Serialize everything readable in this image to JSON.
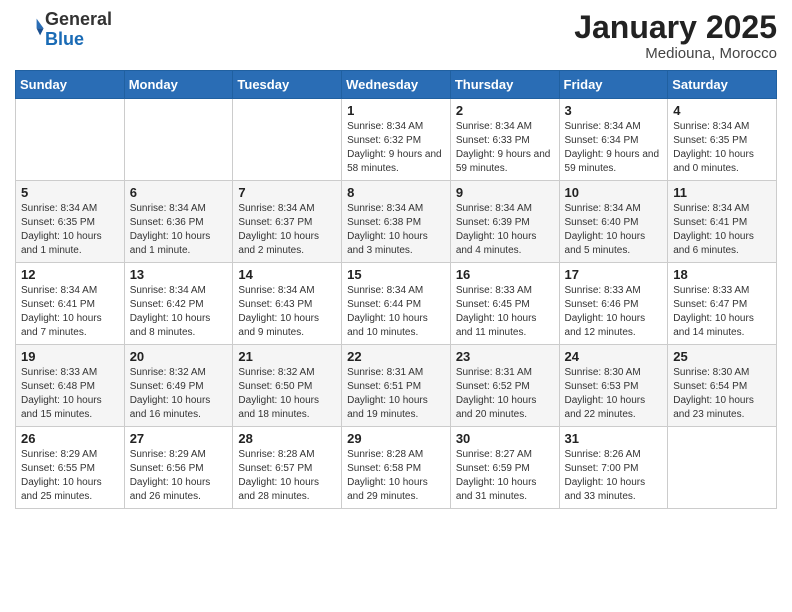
{
  "header": {
    "logo_general": "General",
    "logo_blue": "Blue",
    "month_title": "January 2025",
    "location": "Mediouna, Morocco"
  },
  "days_of_week": [
    "Sunday",
    "Monday",
    "Tuesday",
    "Wednesday",
    "Thursday",
    "Friday",
    "Saturday"
  ],
  "weeks": [
    [
      {
        "day": "",
        "info": ""
      },
      {
        "day": "",
        "info": ""
      },
      {
        "day": "",
        "info": ""
      },
      {
        "day": "1",
        "info": "Sunrise: 8:34 AM\nSunset: 6:32 PM\nDaylight: 9 hours and 58 minutes."
      },
      {
        "day": "2",
        "info": "Sunrise: 8:34 AM\nSunset: 6:33 PM\nDaylight: 9 hours and 59 minutes."
      },
      {
        "day": "3",
        "info": "Sunrise: 8:34 AM\nSunset: 6:34 PM\nDaylight: 9 hours and 59 minutes."
      },
      {
        "day": "4",
        "info": "Sunrise: 8:34 AM\nSunset: 6:35 PM\nDaylight: 10 hours and 0 minutes."
      }
    ],
    [
      {
        "day": "5",
        "info": "Sunrise: 8:34 AM\nSunset: 6:35 PM\nDaylight: 10 hours and 1 minute."
      },
      {
        "day": "6",
        "info": "Sunrise: 8:34 AM\nSunset: 6:36 PM\nDaylight: 10 hours and 1 minute."
      },
      {
        "day": "7",
        "info": "Sunrise: 8:34 AM\nSunset: 6:37 PM\nDaylight: 10 hours and 2 minutes."
      },
      {
        "day": "8",
        "info": "Sunrise: 8:34 AM\nSunset: 6:38 PM\nDaylight: 10 hours and 3 minutes."
      },
      {
        "day": "9",
        "info": "Sunrise: 8:34 AM\nSunset: 6:39 PM\nDaylight: 10 hours and 4 minutes."
      },
      {
        "day": "10",
        "info": "Sunrise: 8:34 AM\nSunset: 6:40 PM\nDaylight: 10 hours and 5 minutes."
      },
      {
        "day": "11",
        "info": "Sunrise: 8:34 AM\nSunset: 6:41 PM\nDaylight: 10 hours and 6 minutes."
      }
    ],
    [
      {
        "day": "12",
        "info": "Sunrise: 8:34 AM\nSunset: 6:41 PM\nDaylight: 10 hours and 7 minutes."
      },
      {
        "day": "13",
        "info": "Sunrise: 8:34 AM\nSunset: 6:42 PM\nDaylight: 10 hours and 8 minutes."
      },
      {
        "day": "14",
        "info": "Sunrise: 8:34 AM\nSunset: 6:43 PM\nDaylight: 10 hours and 9 minutes."
      },
      {
        "day": "15",
        "info": "Sunrise: 8:34 AM\nSunset: 6:44 PM\nDaylight: 10 hours and 10 minutes."
      },
      {
        "day": "16",
        "info": "Sunrise: 8:33 AM\nSunset: 6:45 PM\nDaylight: 10 hours and 11 minutes."
      },
      {
        "day": "17",
        "info": "Sunrise: 8:33 AM\nSunset: 6:46 PM\nDaylight: 10 hours and 12 minutes."
      },
      {
        "day": "18",
        "info": "Sunrise: 8:33 AM\nSunset: 6:47 PM\nDaylight: 10 hours and 14 minutes."
      }
    ],
    [
      {
        "day": "19",
        "info": "Sunrise: 8:33 AM\nSunset: 6:48 PM\nDaylight: 10 hours and 15 minutes."
      },
      {
        "day": "20",
        "info": "Sunrise: 8:32 AM\nSunset: 6:49 PM\nDaylight: 10 hours and 16 minutes."
      },
      {
        "day": "21",
        "info": "Sunrise: 8:32 AM\nSunset: 6:50 PM\nDaylight: 10 hours and 18 minutes."
      },
      {
        "day": "22",
        "info": "Sunrise: 8:31 AM\nSunset: 6:51 PM\nDaylight: 10 hours and 19 minutes."
      },
      {
        "day": "23",
        "info": "Sunrise: 8:31 AM\nSunset: 6:52 PM\nDaylight: 10 hours and 20 minutes."
      },
      {
        "day": "24",
        "info": "Sunrise: 8:30 AM\nSunset: 6:53 PM\nDaylight: 10 hours and 22 minutes."
      },
      {
        "day": "25",
        "info": "Sunrise: 8:30 AM\nSunset: 6:54 PM\nDaylight: 10 hours and 23 minutes."
      }
    ],
    [
      {
        "day": "26",
        "info": "Sunrise: 8:29 AM\nSunset: 6:55 PM\nDaylight: 10 hours and 25 minutes."
      },
      {
        "day": "27",
        "info": "Sunrise: 8:29 AM\nSunset: 6:56 PM\nDaylight: 10 hours and 26 minutes."
      },
      {
        "day": "28",
        "info": "Sunrise: 8:28 AM\nSunset: 6:57 PM\nDaylight: 10 hours and 28 minutes."
      },
      {
        "day": "29",
        "info": "Sunrise: 8:28 AM\nSunset: 6:58 PM\nDaylight: 10 hours and 29 minutes."
      },
      {
        "day": "30",
        "info": "Sunrise: 8:27 AM\nSunset: 6:59 PM\nDaylight: 10 hours and 31 minutes."
      },
      {
        "day": "31",
        "info": "Sunrise: 8:26 AM\nSunset: 7:00 PM\nDaylight: 10 hours and 33 minutes."
      },
      {
        "day": "",
        "info": ""
      }
    ]
  ]
}
